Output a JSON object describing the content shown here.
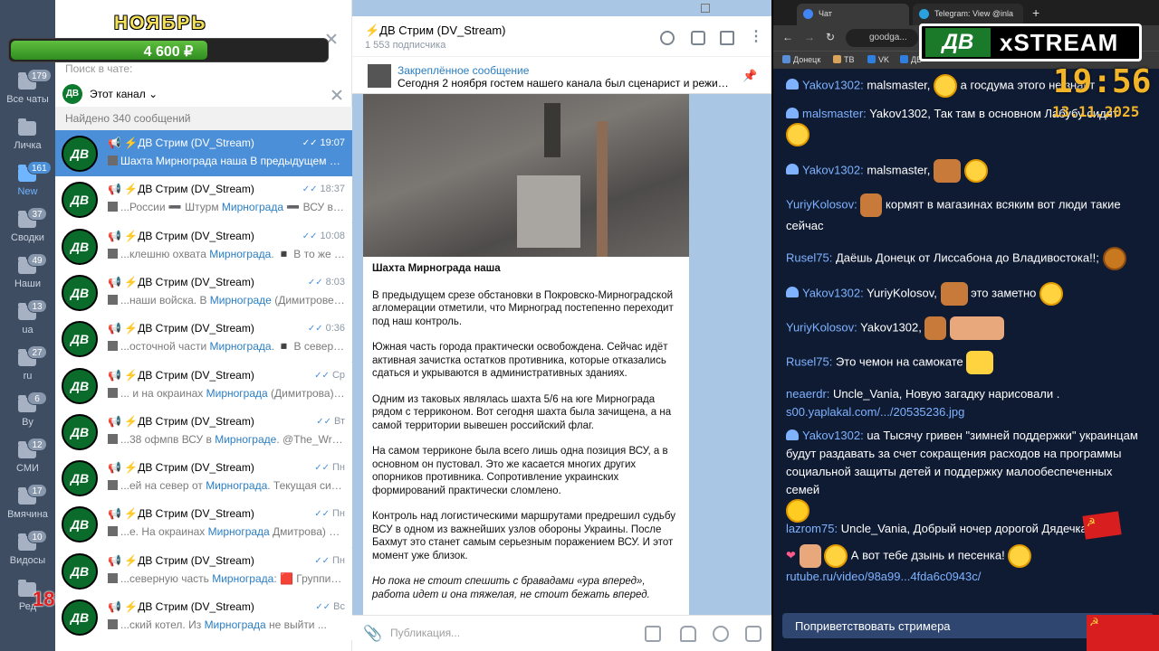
{
  "overlay": {
    "month": "НОЯБРЬ",
    "amount": "4 600 ₽",
    "progress": 0.62,
    "age_badge": "18+"
  },
  "rail": {
    "folders": [
      {
        "label": "Все чаты",
        "badge": "179"
      },
      {
        "label": "Личка",
        "badge": ""
      },
      {
        "label": "New",
        "badge": "161"
      },
      {
        "label": "Сводки",
        "badge": "37"
      },
      {
        "label": "Наши",
        "badge": "49"
      },
      {
        "label": "ua",
        "badge": "13"
      },
      {
        "label": "ru",
        "badge": "27"
      },
      {
        "label": "By",
        "badge": "6"
      },
      {
        "label": "СМИ",
        "badge": "12"
      },
      {
        "label": "Вмячина",
        "badge": "17"
      },
      {
        "label": "Видосы",
        "badge": "10"
      },
      {
        "label": "Ред",
        "badge": ""
      }
    ]
  },
  "search": {
    "hint": "Поиск в чате:",
    "filter": "Этот канал",
    "found": "Найдено 340 сообщений"
  },
  "results": [
    {
      "title": "📢 ⚡ДВ Стрим (DV_Stream)",
      "time": "19:07",
      "pre": "Шахта ",
      "hl": "Мирнограда",
      "post": " наша  В предыдущем сре..."
    },
    {
      "title": "📢 ⚡ДВ Стрим (DV_Stream)",
      "time": "18:37",
      "pre": "...России ➖ Штурм ",
      "hl": "Мирнограда",
      "post": " ➖ ВСУ вгут..."
    },
    {
      "title": "📢 ⚡ДВ Стрим (DV_Stream)",
      "time": "10:08",
      "pre": "...клешню охвата ",
      "hl": "Мирнограда",
      "post": ". ◾ В то же вр..."
    },
    {
      "title": "📢 ⚡ДВ Стрим (DV_Stream)",
      "time": "8:03",
      "pre": "...наши войска. В ",
      "hl": "Мирнограде",
      "post": " (Димитрове) п..."
    },
    {
      "title": "📢 ⚡ДВ Стрим (DV_Stream)",
      "time": "0:36",
      "pre": "...осточной части ",
      "hl": "Мирнограда",
      "post": ". ◾ В северо-в..."
    },
    {
      "title": "📢 ⚡ДВ Стрим (DV_Stream)",
      "time": "Ср",
      "pre": "... и на окраинах ",
      "hl": "Мирнограда",
      "post": " (Димитрова)  ..."
    },
    {
      "title": "📢 ⚡ДВ Стрим (DV_Stream)",
      "time": "Вт",
      "pre": "...38 офмпв ВСУ в ",
      "hl": "Мирнограде",
      "post": ".  @The_Wrong..."
    },
    {
      "title": "📢 ⚡ДВ Стрим (DV_Stream)",
      "time": "Пн",
      "pre": "...ей на север от ",
      "hl": "Мирнограда",
      "post": ".  Текущая ситуа..."
    },
    {
      "title": "📢 ⚡ДВ Стрим (DV_Stream)",
      "time": "Пн",
      "pre": "...е. На окраинах ",
      "hl": "Мирнограда",
      "post": " Дмитрова) пр..."
    },
    {
      "title": "📢 ⚡ДВ Стрим (DV_Stream)",
      "time": "Пн",
      "pre": "...северную часть ",
      "hl": "Мирнограда",
      "post": ": 🟥 Группиро..."
    },
    {
      "title": "📢 ⚡ДВ Стрим (DV_Stream)",
      "time": "Вс",
      "pre": "...ский котел. Из ",
      "hl": "Мирнограда",
      "post": " не выйти ..."
    }
  ],
  "channel": {
    "title": "⚡ДВ Стрим (DV_Stream)",
    "subs": "1 553 подписчика",
    "pinned_title": "Закреплённое сообщение",
    "pinned_text": "Сегодня 2 ноября гостем нашего канала был сценарист и режиссёр...",
    "post_title": "Шахта Мирнограда наша",
    "post_paras": [
      "В предыдущем срезе обстановки в Покровско-Мирноградской агломерации отметили, что Мирноград постепенно переходит под наш контроль.",
      "Южная часть города практически освобождена. Сейчас идёт активная зачистка остатков противника, которые отказались сдаться и укрываются в административных зданиях.",
      "Одним из таковых являлась шахта 5/6 на юге Мирнограда рядом с терриконом. Вот сегодня шахта была зачищена, а на самой территории вывешен российский флаг.",
      "На самом терриконе была всего лишь одна позиция ВСУ, а в основном он пустовал. Это же касается многих других опорников противника. Сопротивление украинских формирований практически сломлено.",
      "Контроль над логистическими маршрутами предрешил судьбу ВСУ в одном из важнейших узлов обороны Украины. После Бахмут это станет самым серьезным поражением ВСУ. И этот момент уже близок."
    ],
    "post_italic": "Но пока не стоит спешить с бравадами «ура вперед», работа идет и она тяжелая, не стоит бежать вперед.",
    "composer_placeholder": "Публикация..."
  },
  "browser": {
    "tab1": "Чат",
    "tab2": "Telegram: View @inla",
    "address": "goodga...",
    "bookmarks": [
      "Донецк",
      "ТВ",
      "VK",
      "ДВ"
    ],
    "brand_left": "ДВ",
    "brand_right": "xSTREAM",
    "clock": "19:56",
    "date": "13.11.2025"
  },
  "chat": [
    {
      "nick": "Yakov1302:",
      "text": "malsmaster,",
      "tail": " а госдума этого не знает"
    },
    {
      "nick": "malsmaster:",
      "text": "Yakov1302, Так там в основном Лабубу сидят",
      "tail": ""
    },
    {
      "nick": "Yakov1302:",
      "text": "malsmaster,",
      "tail": ""
    },
    {
      "nick": "YuriyKolosov:",
      "text": "кормят в магазинах всяким вот люди такие сейчас",
      "tail": ""
    },
    {
      "nick": "Rusel75:",
      "text": "Даёшь Донецк от Лиссабона до Владивостока!!;",
      "tail": ""
    },
    {
      "nick": "Yakov1302:",
      "text": "YuriyKolosov,",
      "tail": " это заметно"
    },
    {
      "nick": "YuriyKolosov:",
      "text": "Yakov1302,",
      "tail": ""
    },
    {
      "nick": "Rusel75:",
      "text": "Это чемон на самокате",
      "tail": ""
    },
    {
      "nick": "neaerdr:",
      "text": "Uncle_Vania, Новую загадку нарисовали .",
      "tail": "s00.yaplakal.com/.../20535236.jpg"
    },
    {
      "nick": "Yakov1302:",
      "text": "ua Тысячу гривен \"зимней поддержки\" украинцам будут раздавать за счет сокращения расходов на программы социальной защиты детей и поддержку малообеспеченных семей",
      "tail": ""
    },
    {
      "nick": "lazrom75:",
      "text": "Uncle_Vania, Добрый ночер дорогой Дядечка!",
      "tail": ""
    },
    {
      "nick": "",
      "text": "А вот тебе дзынь и песенка!",
      "tail": "rutube.ru/video/98a99...4fda6c0943c/"
    }
  ],
  "greet_button": "Поприветствовать стримера"
}
